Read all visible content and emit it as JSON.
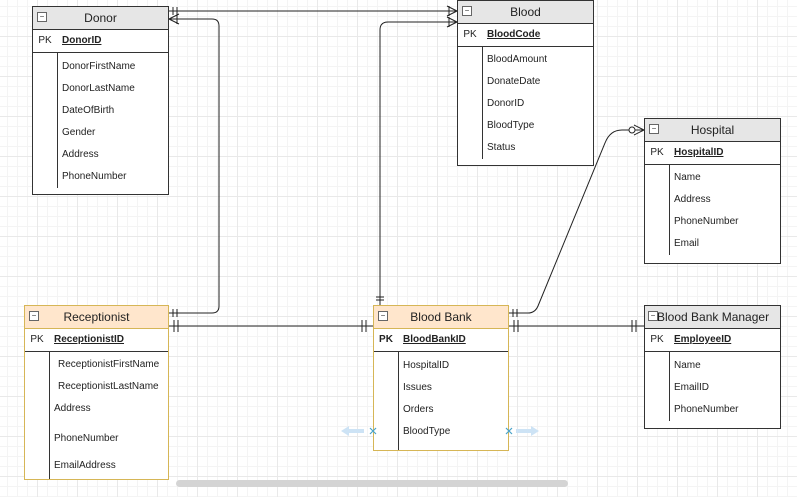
{
  "entities": {
    "donor": {
      "title": "Donor",
      "pk_label": "PK",
      "pk": "DonorID",
      "fields": [
        "DonorFirstName",
        "DonorLastName",
        "DateOfBirth",
        "Gender",
        "Address",
        "PhoneNumber"
      ]
    },
    "blood": {
      "title": "Blood",
      "pk_label": "PK",
      "pk": "BloodCode",
      "fields": [
        "BloodAmount",
        "DonateDate",
        "DonorID",
        "BloodType",
        "Status"
      ]
    },
    "hospital": {
      "title": "Hospital",
      "pk_label": "PK",
      "pk": "HospitalID",
      "fields": [
        "Name",
        "Address",
        "PhoneNumber",
        "Email"
      ]
    },
    "receptionist": {
      "title": "Receptionist",
      "pk_label": "PK",
      "pk": "ReceptionistID",
      "fields": [
        "ReceptionistFirstName",
        "ReceptionistLastName",
        "Address",
        "PhoneNumber",
        "EmailAddress"
      ]
    },
    "blood_bank": {
      "title": "Blood Bank",
      "pk_label": "PK",
      "pk": "BloodBankID",
      "fields": [
        "HospitalID",
        "Issues",
        "Orders",
        "BloodType"
      ]
    },
    "manager": {
      "title": "Blood Bank Manager",
      "pk_label": "PK",
      "pk": "EmployeeID",
      "fields": [
        "Name",
        "EmailID",
        "PhoneNumber"
      ]
    }
  },
  "relationships": [
    {
      "from": "Donor",
      "to": "Blood",
      "from_end": "one-and-only-one",
      "to_end": "one-or-many"
    },
    {
      "from": "Receptionist",
      "to": "Donor",
      "from_end": "one-and-only-one",
      "to_end": "one-or-many"
    },
    {
      "from": "Receptionist",
      "to": "Blood Bank",
      "from_end": "one-and-only-one",
      "to_end": "one-and-only-one"
    },
    {
      "from": "Blood Bank",
      "to": "Blood",
      "from_end": "one-and-only-one",
      "to_end": "one-or-many"
    },
    {
      "from": "Blood Bank",
      "to": "Hospital",
      "from_end": "one-and-only-one",
      "to_end": "zero-or-many"
    },
    {
      "from": "Blood Bank",
      "to": "Blood Bank Manager",
      "from_end": "one-and-only-one",
      "to_end": "one-and-only-one"
    }
  ],
  "colors": {
    "line": "#222222",
    "header_default": "#e6e6e6",
    "header_selected": "#ffe6cc",
    "border_selected": "#d6b656",
    "resize_handle": "#cde3f5",
    "grid": "#e9e9e9"
  }
}
